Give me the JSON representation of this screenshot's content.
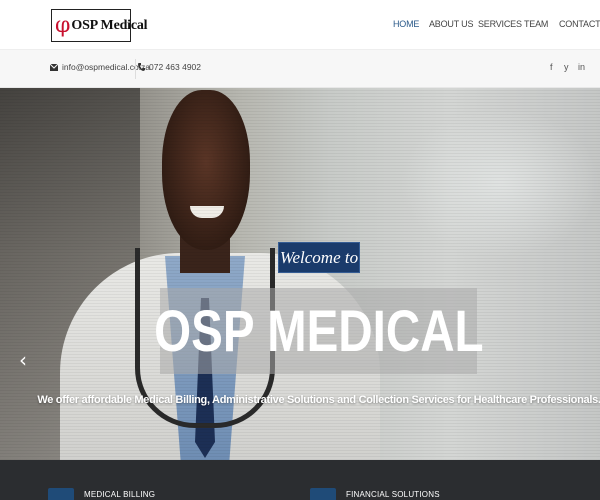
{
  "header": {
    "logo_symbol": "φ",
    "logo_text": "OSP Medical",
    "nav": [
      {
        "label": "HOME",
        "active": true
      },
      {
        "label": "ABOUT US",
        "active": false
      },
      {
        "label": "SERVICES",
        "active": false
      },
      {
        "label": "TEAM",
        "active": false
      },
      {
        "label": "CONTACT",
        "active": false
      }
    ]
  },
  "topbar": {
    "email": "info@ospmedical.co.za",
    "phone": "072 463 4902",
    "social": [
      "f",
      "y",
      "in"
    ]
  },
  "hero": {
    "welcome": "Welcome to",
    "title": "OSP MEDICAL",
    "tagline": "We offer affordable Medical Billing, Administrative Solutions and Collection Services for Healthcare Professionals.",
    "prev_arrow": "‹"
  },
  "services": [
    {
      "label": "MEDICAL BILLING"
    },
    {
      "label": "FINANCIAL SOLUTIONS"
    }
  ],
  "colors": {
    "accent": "#1a3b6b",
    "nav_active": "#2b5a8a",
    "logo_symbol": "#c8102e",
    "footer_bg": "#2b2d30"
  },
  "icons": {
    "email": "envelope-icon",
    "phone": "phone-icon",
    "social": [
      "facebook-icon",
      "twitter-icon",
      "linkedin-icon"
    ]
  }
}
